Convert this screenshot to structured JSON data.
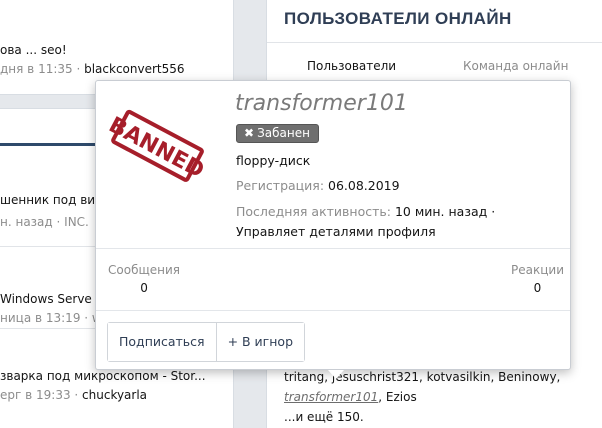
{
  "left_top": {
    "row1_line1": "ова ... seo!",
    "row1_line2_prefix": "дня в 11:35 · ",
    "row1_line2_user": "blackconvert556"
  },
  "left_bottom": {
    "rows": [
      {
        "line1": "шенник под вид",
        "line2": "н. назад · INC."
      },
      {
        "line1": "Windows Serve",
        "line2": "ница в 13:19 · w"
      },
      {
        "line1": "зварка под микроскопом - Stor...",
        "line2_prefix": "ерг в 19:33 · ",
        "line2_user": "chuckyarla"
      }
    ]
  },
  "sidebar": {
    "title": "ПОЛЬЗОВАТЕЛИ ОНЛАЙН",
    "tabs": [
      "Пользователи",
      "Команда онлайн"
    ],
    "online_list_line1": "tritang, jesuschrist321, kotvasilkin, Beninowy,",
    "online_list_user_italic": "transformer101",
    "online_list_after": ", Ezios",
    "online_more": "...и ещё 150."
  },
  "popup": {
    "username": "transformer101",
    "avatar_stamp_text": "BANNED",
    "badge_icon": "close-icon",
    "badge_label": "Забанен",
    "user_title": "floppy-диск",
    "registration_label": "Регистрация:",
    "registration_value": "06.08.2019",
    "activity_label": "Последняя активность:",
    "activity_value": "10 мин. назад · Управляет деталями профиля",
    "messages_label": "Сообщения",
    "messages_count": "0",
    "reactions_label": "Реакции",
    "reactions_count": "0",
    "follow_button": "Подписаться",
    "ignore_button": "+ В игнор"
  },
  "colors": {
    "page_bg": "#e5e8ec",
    "accent_header": "#2e4a6b",
    "sidebar_title": "#2f3e55",
    "badge_bg": "#6f6f6f",
    "stamp_red": "#a61e2a"
  }
}
